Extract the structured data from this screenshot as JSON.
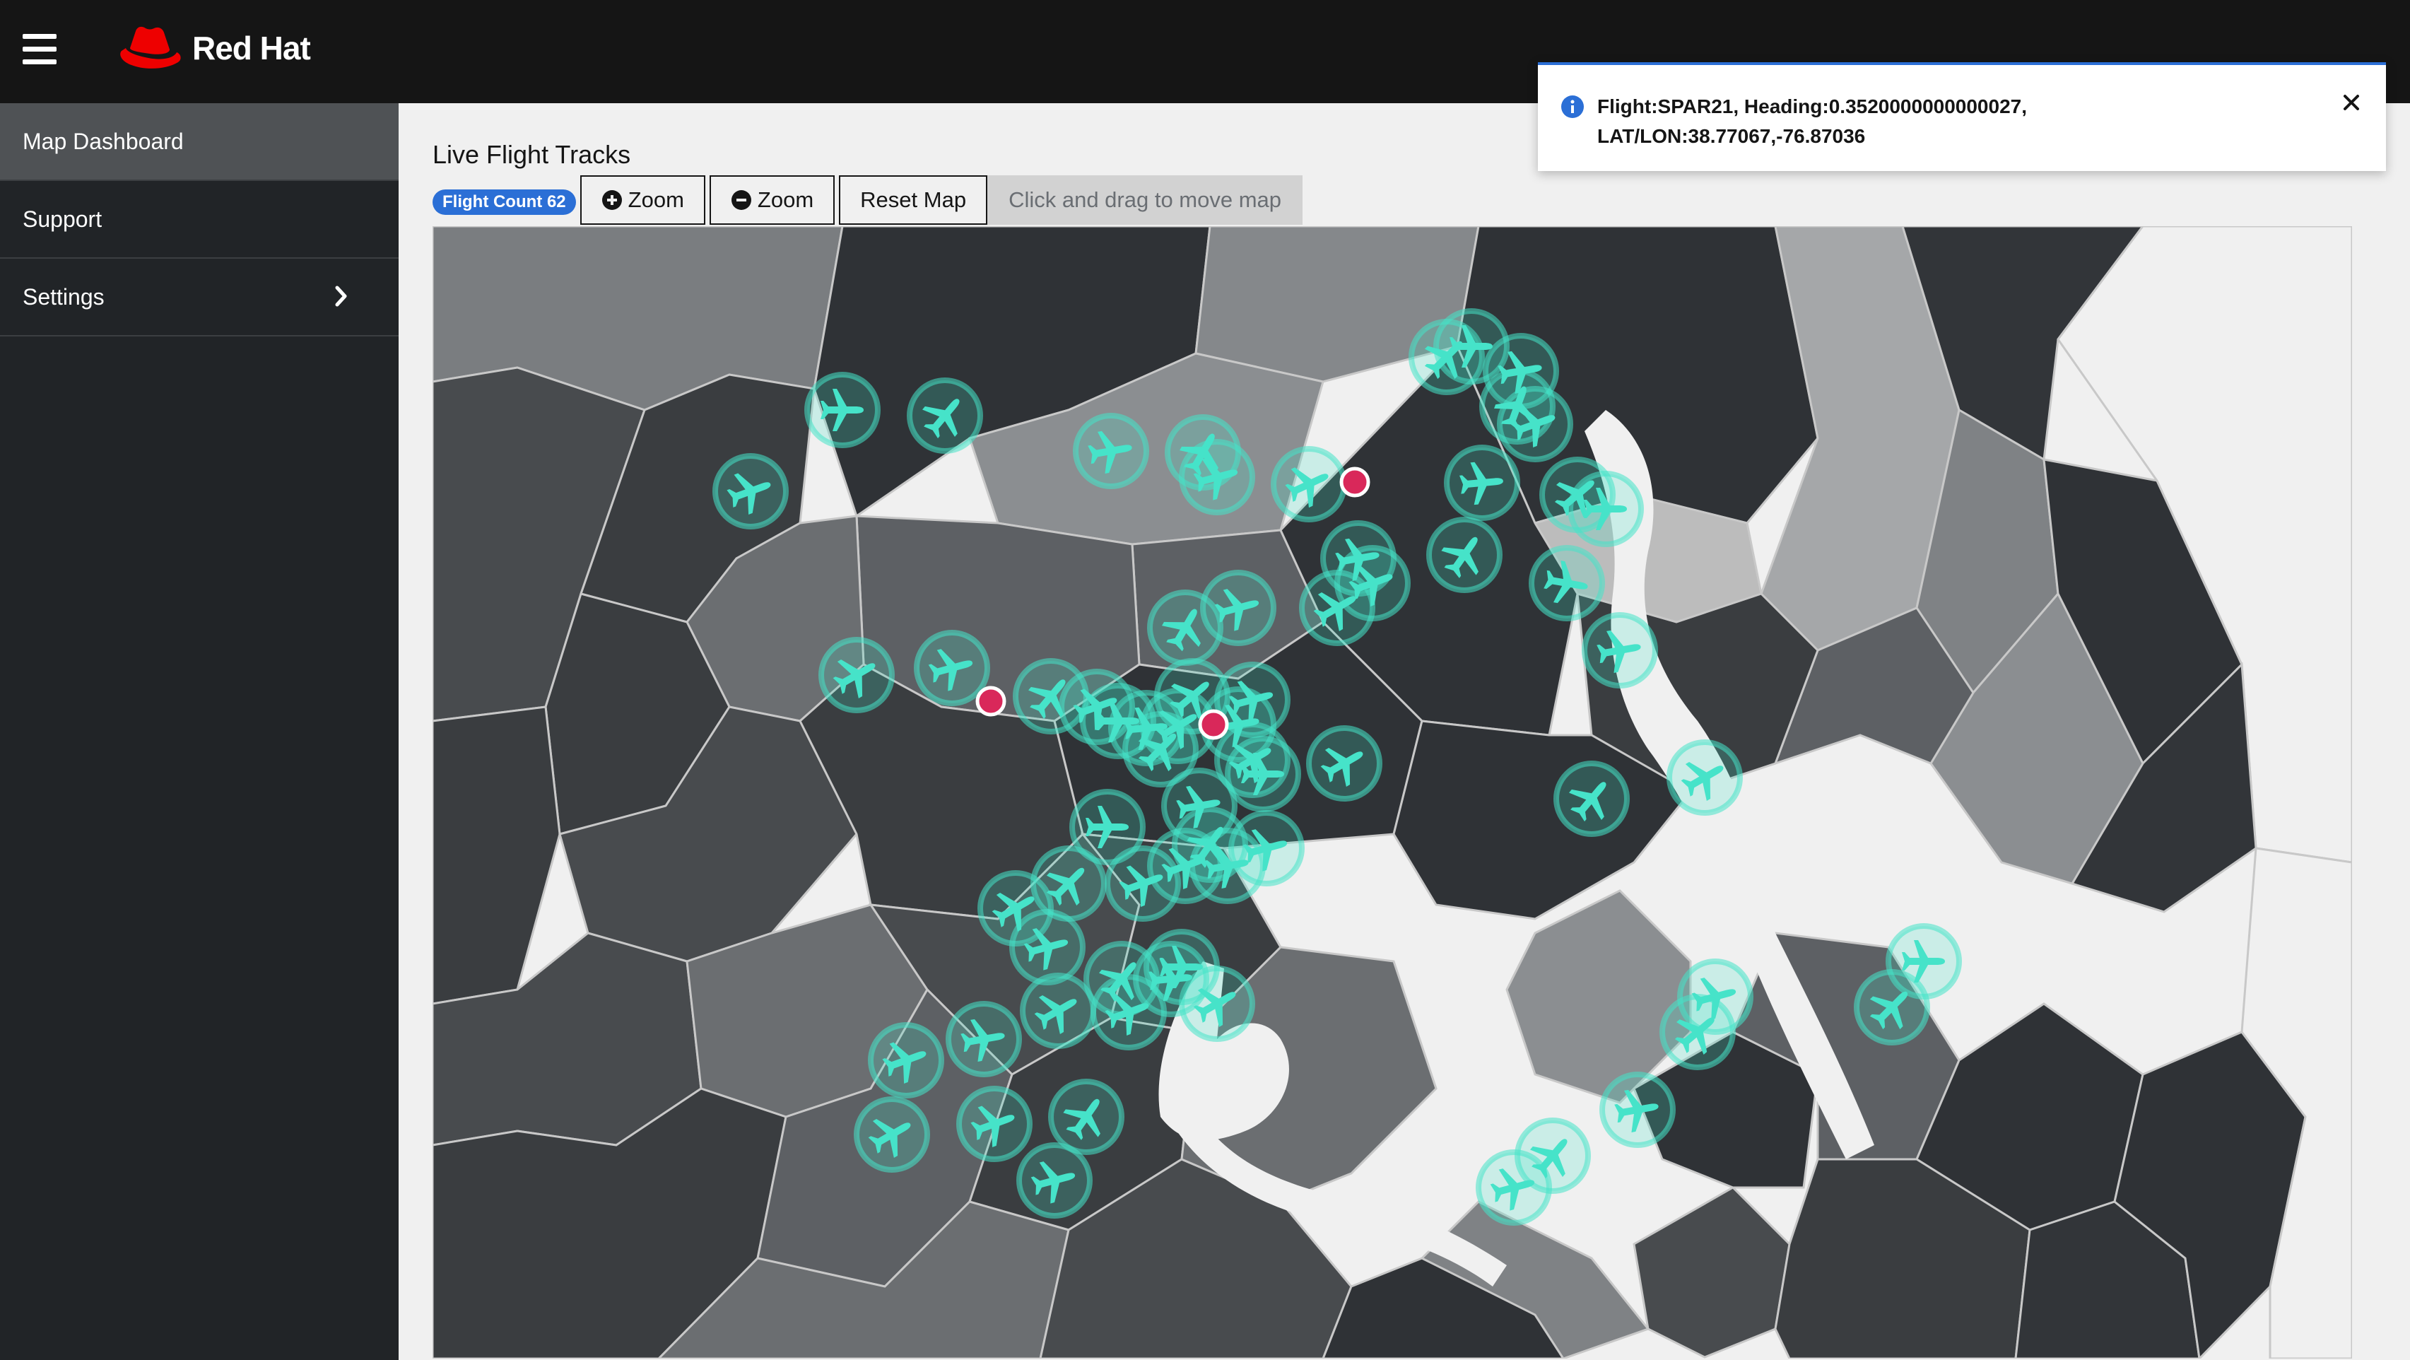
{
  "brand": {
    "name": "Red Hat"
  },
  "nav": {
    "items": [
      {
        "label": "Map Dashboard"
      },
      {
        "label": "Support"
      },
      {
        "label": "Settings"
      }
    ]
  },
  "main": {
    "title": "Live Flight Tracks",
    "flight_count_label": "Flight Count 62",
    "zoom_in_label": "Zoom",
    "zoom_out_label": "Zoom",
    "reset_label": "Reset Map",
    "hint": "Click and drag to move map"
  },
  "alert": {
    "line1": "Flight:SPAR21, Heading:0.3520000000000027,",
    "line2": "LAT/LON:38.77067,-76.87036"
  },
  "icons": [
    "hamburger-icon",
    "red-hat-logo",
    "chevron-right-icon",
    "plus-circle-icon",
    "minus-circle-icon",
    "info-circle-icon",
    "close-icon",
    "airplane-icon"
  ],
  "colors": {
    "masthead": "#151515",
    "sidebar": "#212427",
    "sidebar_active": "#4f5255",
    "badge": "#2b6fd6",
    "aircraft": "#46e3c9",
    "alert_marker": "#d9285a",
    "water": "#f0f0f0"
  }
}
